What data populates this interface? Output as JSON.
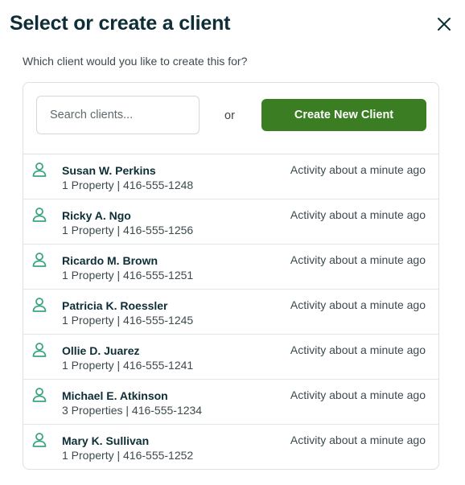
{
  "dialog": {
    "title": "Select or create a client",
    "close_icon": "close-icon",
    "subtitle": "Which client would you like to create this for?"
  },
  "search": {
    "placeholder": "Search clients...",
    "value": ""
  },
  "or_label": "or",
  "create_button_label": "Create New Client",
  "colors": {
    "accent": "#3a7d22",
    "title": "#0d2e36",
    "icon": "#3aa683",
    "border": "#dde1e2"
  },
  "clients": [
    {
      "name": "Susan W. Perkins",
      "properties": "1 Property",
      "phone": "416-555-1248",
      "activity": "Activity about a minute ago",
      "icon": "person-icon"
    },
    {
      "name": "Ricky A. Ngo",
      "properties": "1 Property",
      "phone": "416-555-1256",
      "activity": "Activity about a minute ago",
      "icon": "person-icon"
    },
    {
      "name": "Ricardo M. Brown",
      "properties": "1 Property",
      "phone": "416-555-1251",
      "activity": "Activity about a minute ago",
      "icon": "person-icon"
    },
    {
      "name": "Patricia K. Roessler",
      "properties": "1 Property",
      "phone": "416-555-1245",
      "activity": "Activity about a minute ago",
      "icon": "person-icon"
    },
    {
      "name": "Ollie D. Juarez",
      "properties": "1 Property",
      "phone": "416-555-1241",
      "activity": "Activity about a minute ago",
      "icon": "person-icon"
    },
    {
      "name": "Michael E. Atkinson",
      "properties": "3 Properties",
      "phone": "416-555-1234",
      "activity": "Activity about a minute ago",
      "icon": "person-icon"
    },
    {
      "name": "Mary K. Sullivan",
      "properties": "1 Property",
      "phone": "416-555-1252",
      "activity": "Activity about a minute ago",
      "icon": "person-icon"
    }
  ]
}
